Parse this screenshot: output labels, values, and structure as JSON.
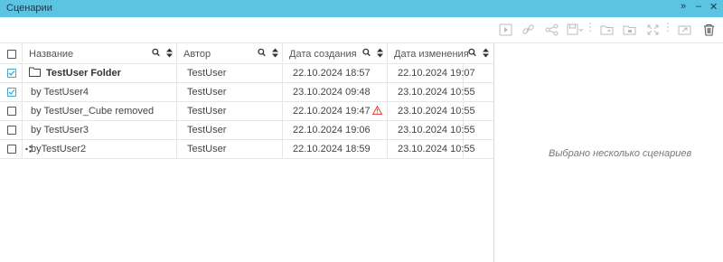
{
  "window": {
    "title": "Сценарии",
    "expand_glyph": "»",
    "minimize_glyph": "–",
    "close_glyph": "✕"
  },
  "toolbar": {
    "buttons": [
      {
        "name": "run-button",
        "icon": "play-icon"
      },
      {
        "name": "link-button",
        "icon": "link-icon"
      },
      {
        "name": "share-button",
        "icon": "share-icon"
      },
      {
        "name": "save-button",
        "icon": "save-icon"
      },
      {
        "name": "move-to-folder-button",
        "icon": "folder-move-icon"
      },
      {
        "name": "archive-button",
        "icon": "folder-lock-icon"
      },
      {
        "name": "expand-button",
        "icon": "expand-icon"
      },
      {
        "name": "export-button",
        "icon": "export-icon"
      },
      {
        "name": "delete-button",
        "icon": "trash-icon"
      }
    ]
  },
  "grid": {
    "columns": [
      "Название",
      "Автор",
      "Дата создания",
      "Дата изменения"
    ],
    "rows": [
      {
        "name": "TestUser Folder",
        "author": "TestUser",
        "created": "22.10.2024 18:57",
        "modified": "22.10.2024 19:07",
        "checked": true,
        "folder": true,
        "warning": false
      },
      {
        "name": "by TestUser4",
        "author": "TestUser",
        "created": "23.10.2024 09:48",
        "modified": "23.10.2024 10:55",
        "checked": true,
        "folder": false,
        "warning": false
      },
      {
        "name": "by TestUser_Cube removed",
        "author": "TestUser",
        "created": "22.10.2024 19:47",
        "modified": "23.10.2024 10:55",
        "checked": false,
        "folder": false,
        "warning": true
      },
      {
        "name": "by TestUser3",
        "author": "TestUser",
        "created": "22.10.2024 19:06",
        "modified": "23.10.2024 10:55",
        "checked": false,
        "folder": false,
        "warning": false
      },
      {
        "name": "byTestUser2",
        "author": "TestUser",
        "created": "22.10.2024 18:59",
        "modified": "23.10.2024 10:55",
        "checked": false,
        "folder": false,
        "warning": false,
        "shared": true
      }
    ]
  },
  "detail": {
    "message": "Выбрано несколько сценариев"
  },
  "colors": {
    "titlebar": "#5bc4e0",
    "check_accent": "#39a7d6",
    "warning": "#e53935"
  }
}
